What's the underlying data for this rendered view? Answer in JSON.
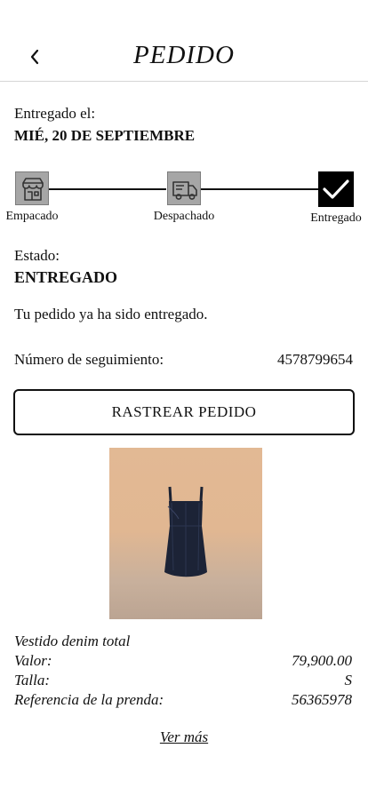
{
  "header": {
    "title": "PEDIDO",
    "back_icon": "chevron-left-icon"
  },
  "delivery": {
    "label": "Entregado el:",
    "date": "MIÉ, 20 DE SEPTIEMBRE"
  },
  "progress": {
    "steps": [
      {
        "label": "Empacado",
        "icon": "store-icon",
        "state": "completed"
      },
      {
        "label": "Despachado",
        "icon": "truck-icon",
        "state": "completed"
      },
      {
        "label": "Entregado",
        "icon": "check-icon",
        "state": "current"
      }
    ],
    "colors": {
      "pending": "#a6a6a6",
      "current": "#000000"
    }
  },
  "status": {
    "label": "Estado:",
    "value": "ENTREGADO",
    "message": "Tu pedido ya ha sido entregado."
  },
  "tracking": {
    "label": "Número de seguimiento:",
    "number": "4578799654"
  },
  "track_button": {
    "label": "RASTREAR PEDIDO"
  },
  "product": {
    "image_icon": "dress-image",
    "name": "Vestido denim total",
    "price_label": "Valor:",
    "price": "79,900.00",
    "size_label": "Talla:",
    "size": "S",
    "ref_label": "Referencia de la prenda:",
    "ref": "56365978"
  },
  "more_link": {
    "label": "Ver más"
  }
}
